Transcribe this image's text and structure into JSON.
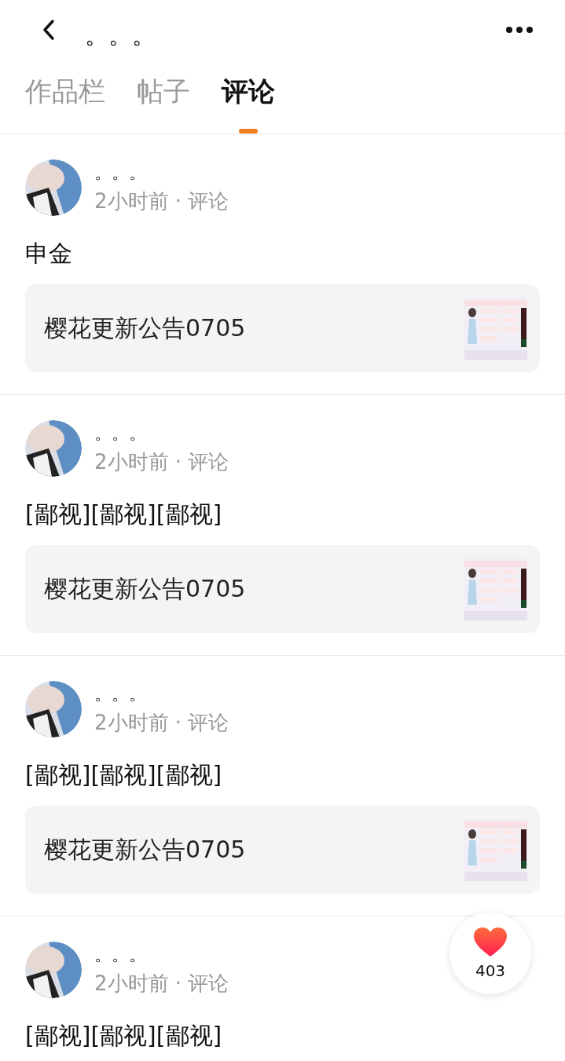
{
  "header": {
    "title": "。。。"
  },
  "tabs": [
    {
      "label": "作品栏",
      "selected": false
    },
    {
      "label": "帖子",
      "selected": false
    },
    {
      "label": "评论",
      "selected": true
    }
  ],
  "comments": [
    {
      "name": "。。。",
      "meta": "2小时前 · 评论",
      "text": "申金",
      "ref": {
        "title": "樱花更新公告0705",
        "kind": "picture"
      }
    },
    {
      "name": "。。。",
      "meta": "2小时前 · 评论",
      "text": "[鄙视][鄙视][鄙视]",
      "ref": {
        "title": "樱花更新公告0705",
        "kind": "picture"
      }
    },
    {
      "name": "。。。",
      "meta": "2小时前 · 评论",
      "text": "[鄙视][鄙视][鄙视]",
      "ref": {
        "title": "樱花更新公告0705",
        "kind": "picture"
      }
    },
    {
      "name": "。。。",
      "meta": "2小时前 · 评论",
      "text": "[鄙视][鄙视][鄙视]"
    }
  ],
  "like": {
    "count": "403"
  }
}
